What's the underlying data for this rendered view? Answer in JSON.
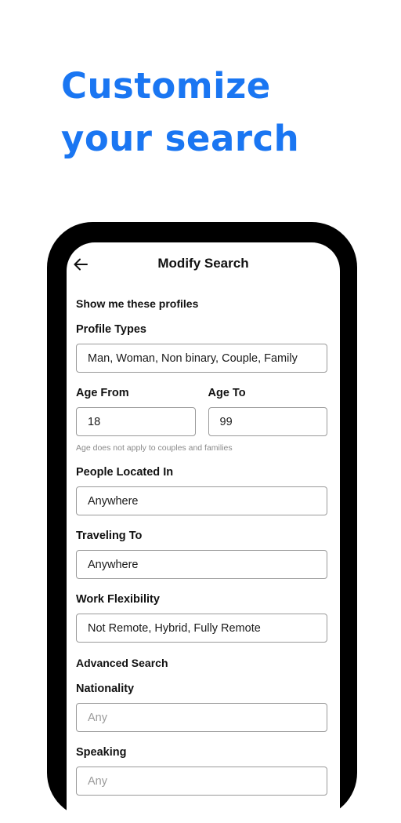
{
  "headline": {
    "line1": "Customize",
    "line2": "your search"
  },
  "screen": {
    "title": "Modify Search",
    "back_icon": "arrow-left-icon",
    "section_profiles": "Show me these profiles",
    "profile_types": {
      "label": "Profile Types",
      "value": "Man, Woman, Non binary, Couple, Family"
    },
    "age_from": {
      "label": "Age From",
      "value": "18"
    },
    "age_to": {
      "label": "Age To",
      "value": "99"
    },
    "age_hint": "Age does not apply to couples and families",
    "located_in": {
      "label": "People Located In",
      "value": "Anywhere"
    },
    "traveling_to": {
      "label": "Traveling To",
      "value": "Anywhere"
    },
    "work_flexibility": {
      "label": "Work Flexibility",
      "value": "Not Remote, Hybrid, Fully Remote"
    },
    "section_advanced": "Advanced Search",
    "nationality": {
      "label": "Nationality",
      "placeholder": "Any"
    },
    "speaking": {
      "label": "Speaking",
      "placeholder": "Any"
    }
  },
  "colors": {
    "accent": "#1a76f2",
    "phone_frame": "#000000",
    "field_border": "#9a9a9a"
  }
}
